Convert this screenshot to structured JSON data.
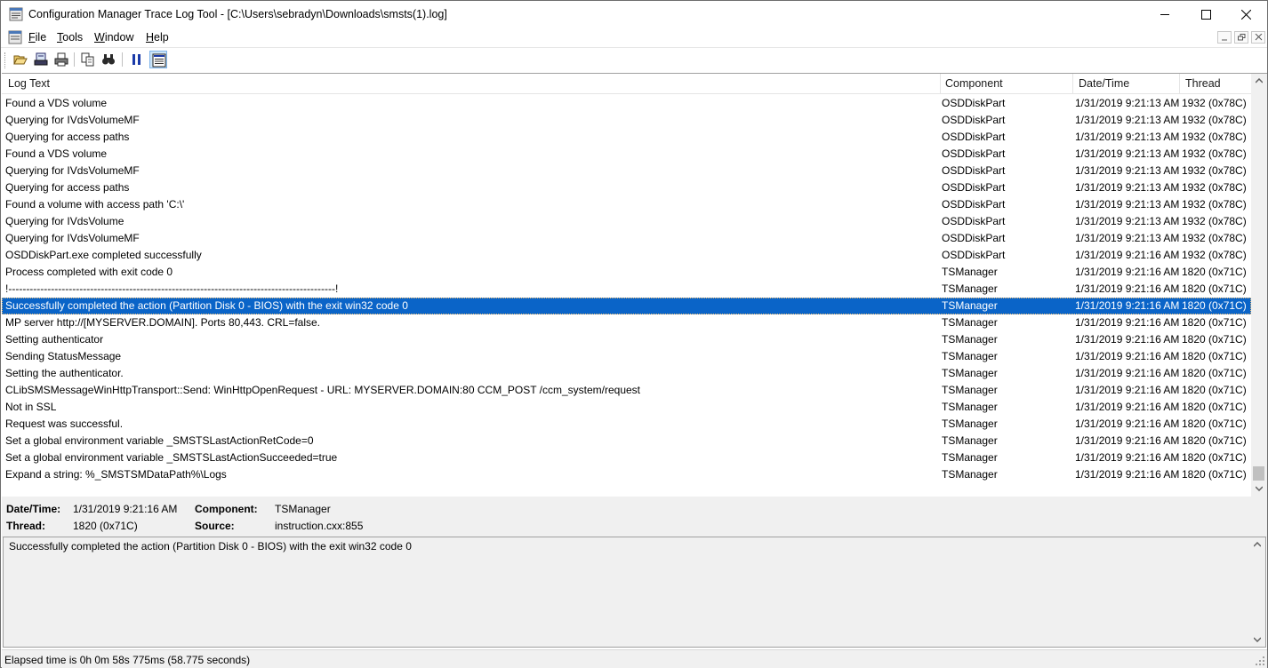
{
  "window": {
    "title": "Configuration Manager Trace Log Tool - [C:\\Users\\sebradyn\\Downloads\\smsts(1).log]",
    "icon": "app-icon"
  },
  "menu": {
    "items": [
      {
        "label": "File",
        "accel": "F",
        "rest": "ile"
      },
      {
        "label": "Tools",
        "accel": "T",
        "rest": "ools"
      },
      {
        "label": "Window",
        "accel": "W",
        "rest": "indow"
      },
      {
        "label": "Help",
        "accel": "H",
        "rest": "elp"
      }
    ]
  },
  "toolbar": {
    "buttons": [
      "open-icon",
      "print-setup-icon",
      "print-icon",
      "copy-icon",
      "find-icon",
      "pause-icon",
      "highlight-icon"
    ],
    "active": "highlight-icon"
  },
  "log": {
    "columns": {
      "text": "Log Text",
      "component": "Component",
      "datetime": "Date/Time",
      "thread": "Thread"
    },
    "rows": [
      {
        "text": "Found a VDS volume",
        "component": "OSDDiskPart",
        "datetime": "1/31/2019 9:21:13 AM",
        "thread": "1932 (0x78C)"
      },
      {
        "text": "Querying for IVdsVolumeMF",
        "component": "OSDDiskPart",
        "datetime": "1/31/2019 9:21:13 AM",
        "thread": "1932 (0x78C)"
      },
      {
        "text": "Querying for access paths",
        "component": "OSDDiskPart",
        "datetime": "1/31/2019 9:21:13 AM",
        "thread": "1932 (0x78C)"
      },
      {
        "text": "Found a VDS volume",
        "component": "OSDDiskPart",
        "datetime": "1/31/2019 9:21:13 AM",
        "thread": "1932 (0x78C)"
      },
      {
        "text": "Querying for IVdsVolumeMF",
        "component": "OSDDiskPart",
        "datetime": "1/31/2019 9:21:13 AM",
        "thread": "1932 (0x78C)"
      },
      {
        "text": "Querying for access paths",
        "component": "OSDDiskPart",
        "datetime": "1/31/2019 9:21:13 AM",
        "thread": "1932 (0x78C)"
      },
      {
        "text": "Found a volume with access path 'C:\\'",
        "component": "OSDDiskPart",
        "datetime": "1/31/2019 9:21:13 AM",
        "thread": "1932 (0x78C)"
      },
      {
        "text": "Querying for IVdsVolume",
        "component": "OSDDiskPart",
        "datetime": "1/31/2019 9:21:13 AM",
        "thread": "1932 (0x78C)"
      },
      {
        "text": "Querying for IVdsVolumeMF",
        "component": "OSDDiskPart",
        "datetime": "1/31/2019 9:21:13 AM",
        "thread": "1932 (0x78C)"
      },
      {
        "text": "OSDDiskPart.exe completed successfully",
        "component": "OSDDiskPart",
        "datetime": "1/31/2019 9:21:16 AM",
        "thread": "1932 (0x78C)"
      },
      {
        "text": "Process completed with exit code 0",
        "component": "TSManager",
        "datetime": "1/31/2019 9:21:16 AM",
        "thread": "1820 (0x71C)"
      },
      {
        "text": "!--------------------------------------------------------------------------------------------!",
        "component": "TSManager",
        "datetime": "1/31/2019 9:21:16 AM",
        "thread": "1820 (0x71C)"
      },
      {
        "text": "Successfully completed the action (Partition Disk 0 - BIOS) with the exit win32 code 0",
        "component": "TSManager",
        "datetime": "1/31/2019 9:21:16 AM",
        "thread": "1820 (0x71C)",
        "selected": true
      },
      {
        "text": "MP server http://[MYSERVER.DOMAIN]. Ports 80,443. CRL=false.",
        "component": "TSManager",
        "datetime": "1/31/2019 9:21:16 AM",
        "thread": "1820 (0x71C)"
      },
      {
        "text": "Setting authenticator",
        "component": "TSManager",
        "datetime": "1/31/2019 9:21:16 AM",
        "thread": "1820 (0x71C)"
      },
      {
        "text": "Sending StatusMessage",
        "component": "TSManager",
        "datetime": "1/31/2019 9:21:16 AM",
        "thread": "1820 (0x71C)"
      },
      {
        "text": "Setting the authenticator.",
        "component": "TSManager",
        "datetime": "1/31/2019 9:21:16 AM",
        "thread": "1820 (0x71C)"
      },
      {
        "text": "CLibSMSMessageWinHttpTransport::Send: WinHttpOpenRequest - URL: MYSERVER.DOMAIN:80  CCM_POST /ccm_system/request",
        "component": "TSManager",
        "datetime": "1/31/2019 9:21:16 AM",
        "thread": "1820 (0x71C)"
      },
      {
        "text": "Not in SSL",
        "component": "TSManager",
        "datetime": "1/31/2019 9:21:16 AM",
        "thread": "1820 (0x71C)"
      },
      {
        "text": "Request was successful.",
        "component": "TSManager",
        "datetime": "1/31/2019 9:21:16 AM",
        "thread": "1820 (0x71C)"
      },
      {
        "text": "Set a global environment variable _SMSTSLastActionRetCode=0",
        "component": "TSManager",
        "datetime": "1/31/2019 9:21:16 AM",
        "thread": "1820 (0x71C)"
      },
      {
        "text": "Set a global environment variable _SMSTSLastActionSucceeded=true",
        "component": "TSManager",
        "datetime": "1/31/2019 9:21:16 AM",
        "thread": "1820 (0x71C)"
      },
      {
        "text": "Expand a string: %_SMSTSMDataPath%\\Logs",
        "component": "TSManager",
        "datetime": "1/31/2019 9:21:16 AM",
        "thread": "1820 (0x71C)"
      }
    ]
  },
  "details": {
    "datetime_label": "Date/Time:",
    "datetime_value": "1/31/2019 9:21:16 AM",
    "component_label": "Component:",
    "component_value": "TSManager",
    "thread_label": "Thread:",
    "thread_value": "1820 (0x71C)",
    "source_label": "Source:",
    "source_value": "instruction.cxx:855",
    "message": "Successfully completed the action (Partition Disk 0 - BIOS) with the exit win32 code 0"
  },
  "status": {
    "text": "Elapsed time is 0h 0m 58s 775ms (58.775 seconds)"
  },
  "colors": {
    "selection": "#0a64c8",
    "panel": "#f0f0f0"
  }
}
